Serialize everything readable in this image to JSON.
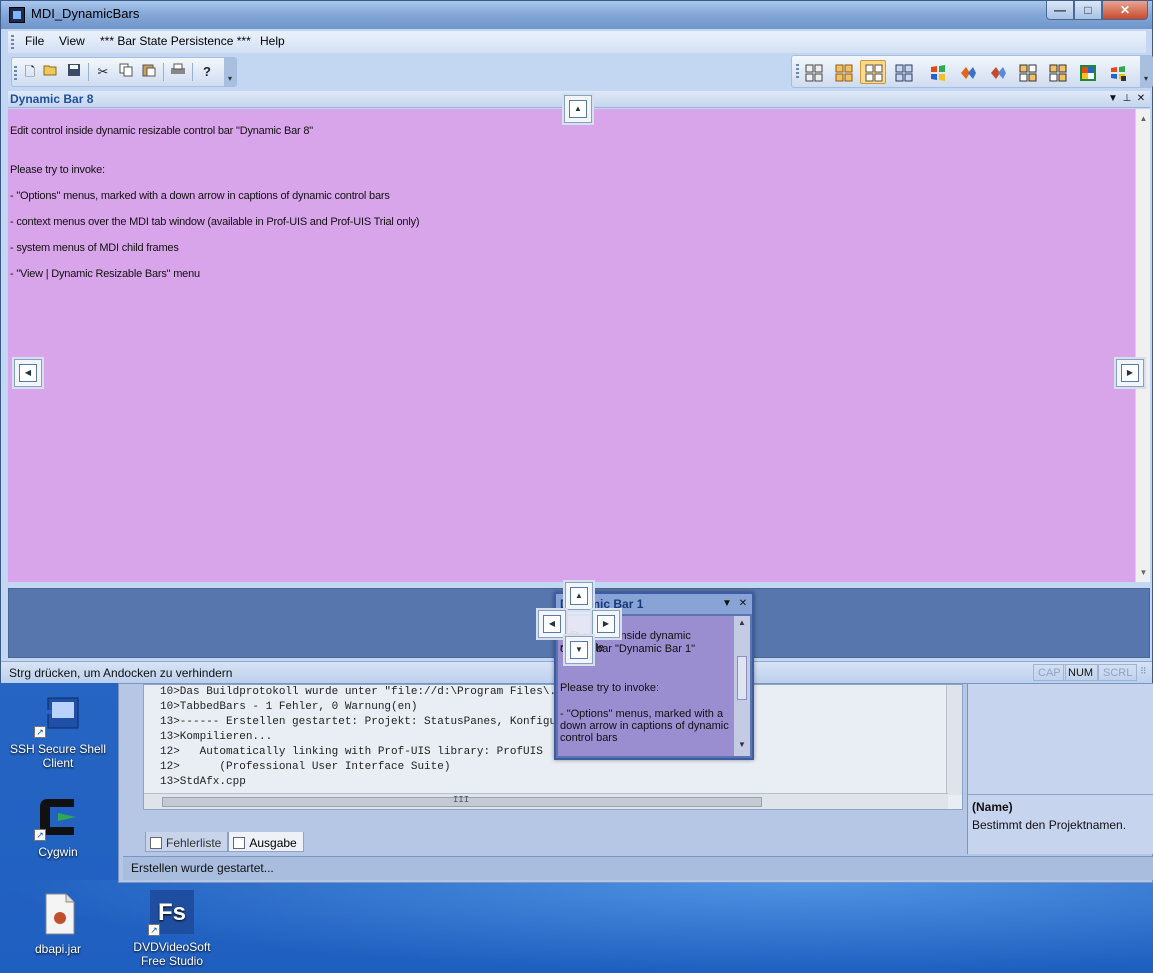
{
  "window": {
    "title": "MDI_DynamicBars",
    "buttons": {
      "minimize": "—",
      "maximize": "□",
      "close": "✕"
    }
  },
  "menu": {
    "file": "File",
    "view": "View",
    "bar_state": "*** Bar State Persistence ***",
    "help": "Help"
  },
  "toolbar": {
    "icons": [
      "new-icon",
      "open-icon",
      "save-icon",
      "cut-icon",
      "copy-icon",
      "paste-icon",
      "print-icon",
      "help-icon"
    ]
  },
  "theme_toolbar": {
    "icons": [
      "theme-classic-icon",
      "theme-office2000-icon",
      "theme-officexp-icon",
      "theme-office2003-icon",
      "theme-xp-icon",
      "theme-vs2008-icon",
      "theme-vs2005-icon",
      "theme-office2007-blue-icon",
      "theme-office2007-black-icon",
      "theme-office2007-silver-icon",
      "theme-studio-icon"
    ],
    "active_index": 2
  },
  "bar8": {
    "caption": "Dynamic Bar 8",
    "lines": [
      "Edit control inside dynamic resizable control bar \"Dynamic Bar 8\"",
      "Please try to invoke:",
      "- \"Options\" menus, marked with a down arrow in captions of dynamic control bars",
      "- context menus over the MDI tab window (available in Prof-UIS and Prof-UIS Trial only)",
      "- system menus of MDI child frames",
      "- \"View | Dynamic Resizable Bars\" menu"
    ],
    "background": "#d9a5ea"
  },
  "bar1": {
    "caption": "Dynamic Bar 1",
    "lines": [
      "Edit control inside dynamic resizable",
      "control bar \"Dynamic Bar 1\"",
      "Please try to invoke:",
      "- \"Options\" menus, marked with a",
      "down arrow in captions of dynamic",
      "control bars"
    ]
  },
  "status": {
    "message": "Strg drücken, um Andocken zu verhindern",
    "cap": "CAP",
    "num": "NUM",
    "scrl": "SCRL"
  },
  "background_app": {
    "output_lines": [
      "10>Das Buildprotokoll wurde unter \"file://d:\\Program Files\\...\\Bin_900\\MbcsDEBUG\\TabbedBa",
      "10>TabbedBars - 1 Fehler, 0 Warnung(en)",
      "13>------ Erstellen gestartet: Projekt: StatusPanes, Konfiguration: ...------",
      "13>Kompilieren...",
      "12>   Automatically linking with Prof-UIS library: ProfUIS",
      "12>      (Professional User Interface Suite)",
      "13>StdAfx.cpp"
    ],
    "scroll_thumb": "III",
    "tabs": [
      "Fehlerliste",
      "Ausgabe"
    ],
    "status": "Erstellen wurde gestartet...",
    "property_name": "(Name)",
    "property_desc": "Bestimmt den Projektnamen."
  },
  "desktop": {
    "icons": [
      {
        "label": "SSH Secure Shell Client"
      },
      {
        "label": "Cygwin"
      },
      {
        "label": "dbapi.jar"
      },
      {
        "label": "DVDVideoSoft Free Studio"
      }
    ]
  }
}
